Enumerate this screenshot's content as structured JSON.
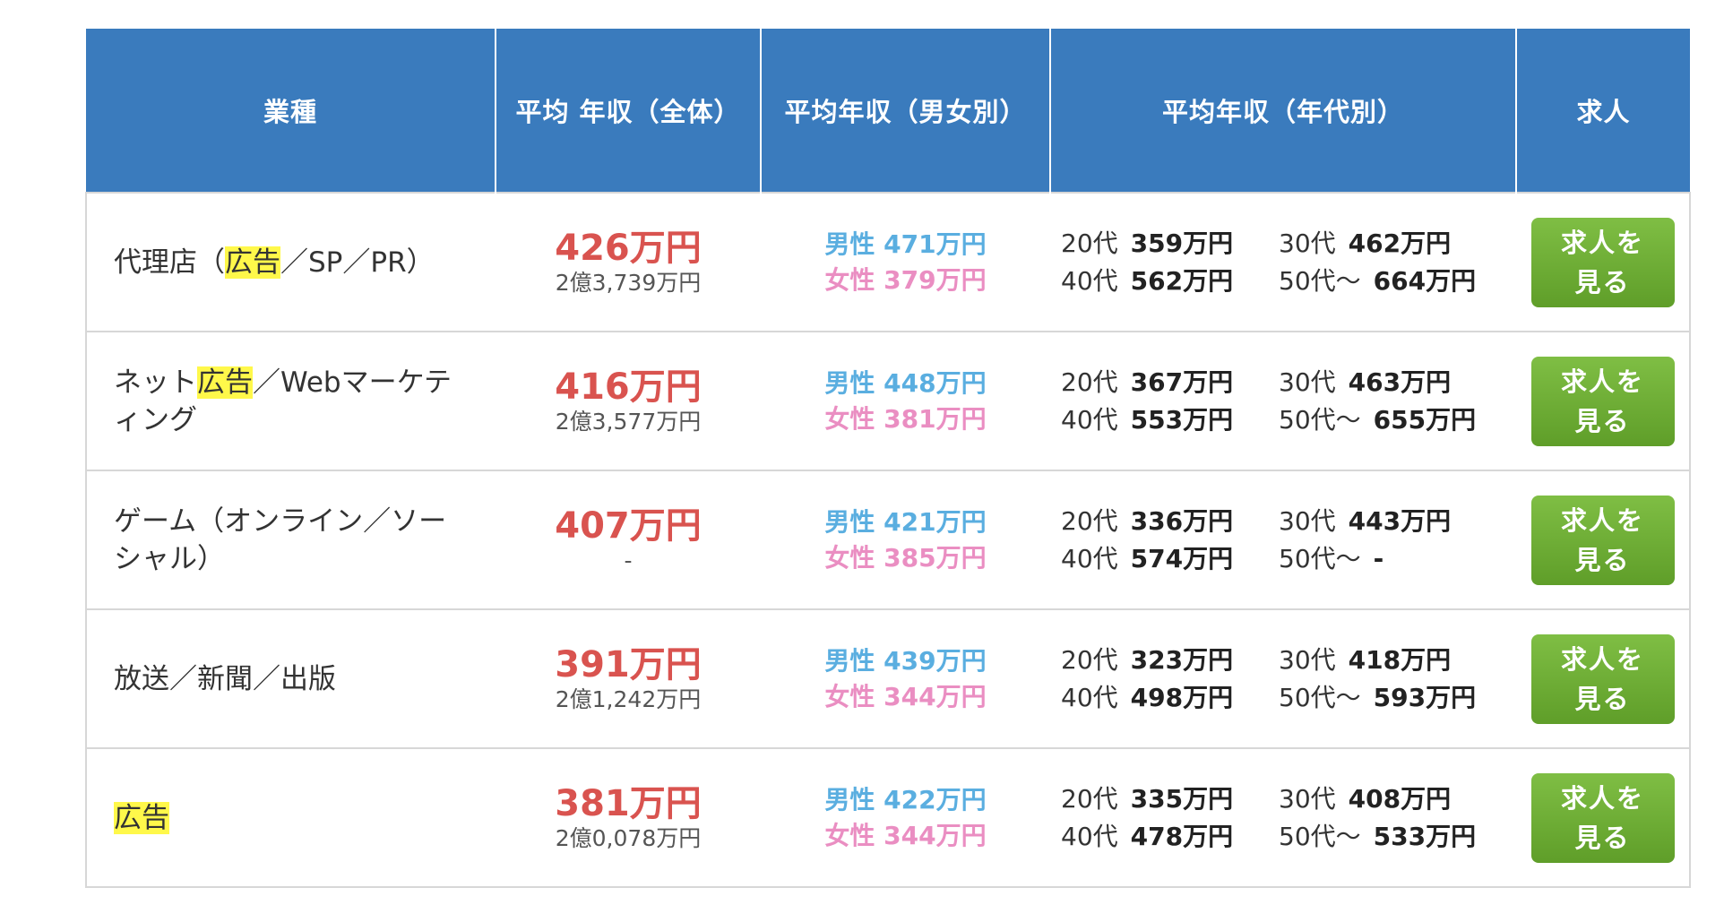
{
  "headers": {
    "industry": "業種",
    "avg_total": "平均 年収（全体）",
    "avg_gender": "平均年収（男女別）",
    "avg_age": "平均年収（年代別）",
    "jobs": "求人"
  },
  "colors": {
    "header_bg": "#3a7bbd",
    "average": "#d9534f",
    "male": "#5aaee0",
    "female": "#ea8ec2",
    "button": "#6aaa33",
    "highlight": "#fff84a"
  },
  "rows": [
    {
      "industry": {
        "pre": "代理店（",
        "hl": "広告",
        "post": "／SP／PR）"
      },
      "avg": "426万円",
      "total": "2億3,739万円",
      "male": "男性 471万円",
      "female": "女性 379万円",
      "ages": [
        {
          "label": "20代",
          "value": "359万円"
        },
        {
          "label": "30代",
          "value": "462万円"
        },
        {
          "label": "40代",
          "value": "562万円"
        },
        {
          "label": "50代〜",
          "value": "664万円"
        }
      ],
      "button": {
        "line1": "求人を",
        "line2": "見る"
      }
    },
    {
      "industry": {
        "pre": "ネット",
        "hl": "広告",
        "post": "／Webマーケティング"
      },
      "avg": "416万円",
      "total": "2億3,577万円",
      "male": "男性 448万円",
      "female": "女性 381万円",
      "ages": [
        {
          "label": "20代",
          "value": "367万円"
        },
        {
          "label": "30代",
          "value": "463万円"
        },
        {
          "label": "40代",
          "value": "553万円"
        },
        {
          "label": "50代〜",
          "value": "655万円"
        }
      ],
      "button": {
        "line1": "求人を",
        "line2": "見る"
      }
    },
    {
      "industry": {
        "pre": "ゲーム（オンライン／ソーシャル）",
        "hl": "",
        "post": ""
      },
      "avg": "407万円",
      "total": "-",
      "male": "男性 421万円",
      "female": "女性 385万円",
      "ages": [
        {
          "label": "20代",
          "value": "336万円"
        },
        {
          "label": "30代",
          "value": "443万円"
        },
        {
          "label": "40代",
          "value": "574万円"
        },
        {
          "label": "50代〜",
          "value": "-"
        }
      ],
      "button": {
        "line1": "求人を",
        "line2": "見る"
      }
    },
    {
      "industry": {
        "pre": "放送／新聞／出版",
        "hl": "",
        "post": ""
      },
      "avg": "391万円",
      "total": "2億1,242万円",
      "male": "男性 439万円",
      "female": "女性 344万円",
      "ages": [
        {
          "label": "20代",
          "value": "323万円"
        },
        {
          "label": "30代",
          "value": "418万円"
        },
        {
          "label": "40代",
          "value": "498万円"
        },
        {
          "label": "50代〜",
          "value": "593万円"
        }
      ],
      "button": {
        "line1": "求人を",
        "line2": "見る"
      }
    },
    {
      "industry": {
        "pre": "",
        "hl": "広告",
        "post": ""
      },
      "avg": "381万円",
      "total": "2億0,078万円",
      "male": "男性 422万円",
      "female": "女性 344万円",
      "ages": [
        {
          "label": "20代",
          "value": "335万円"
        },
        {
          "label": "30代",
          "value": "408万円"
        },
        {
          "label": "40代",
          "value": "478万円"
        },
        {
          "label": "50代〜",
          "value": "533万円"
        }
      ],
      "button": {
        "line1": "求人を",
        "line2": "見る"
      }
    }
  ]
}
